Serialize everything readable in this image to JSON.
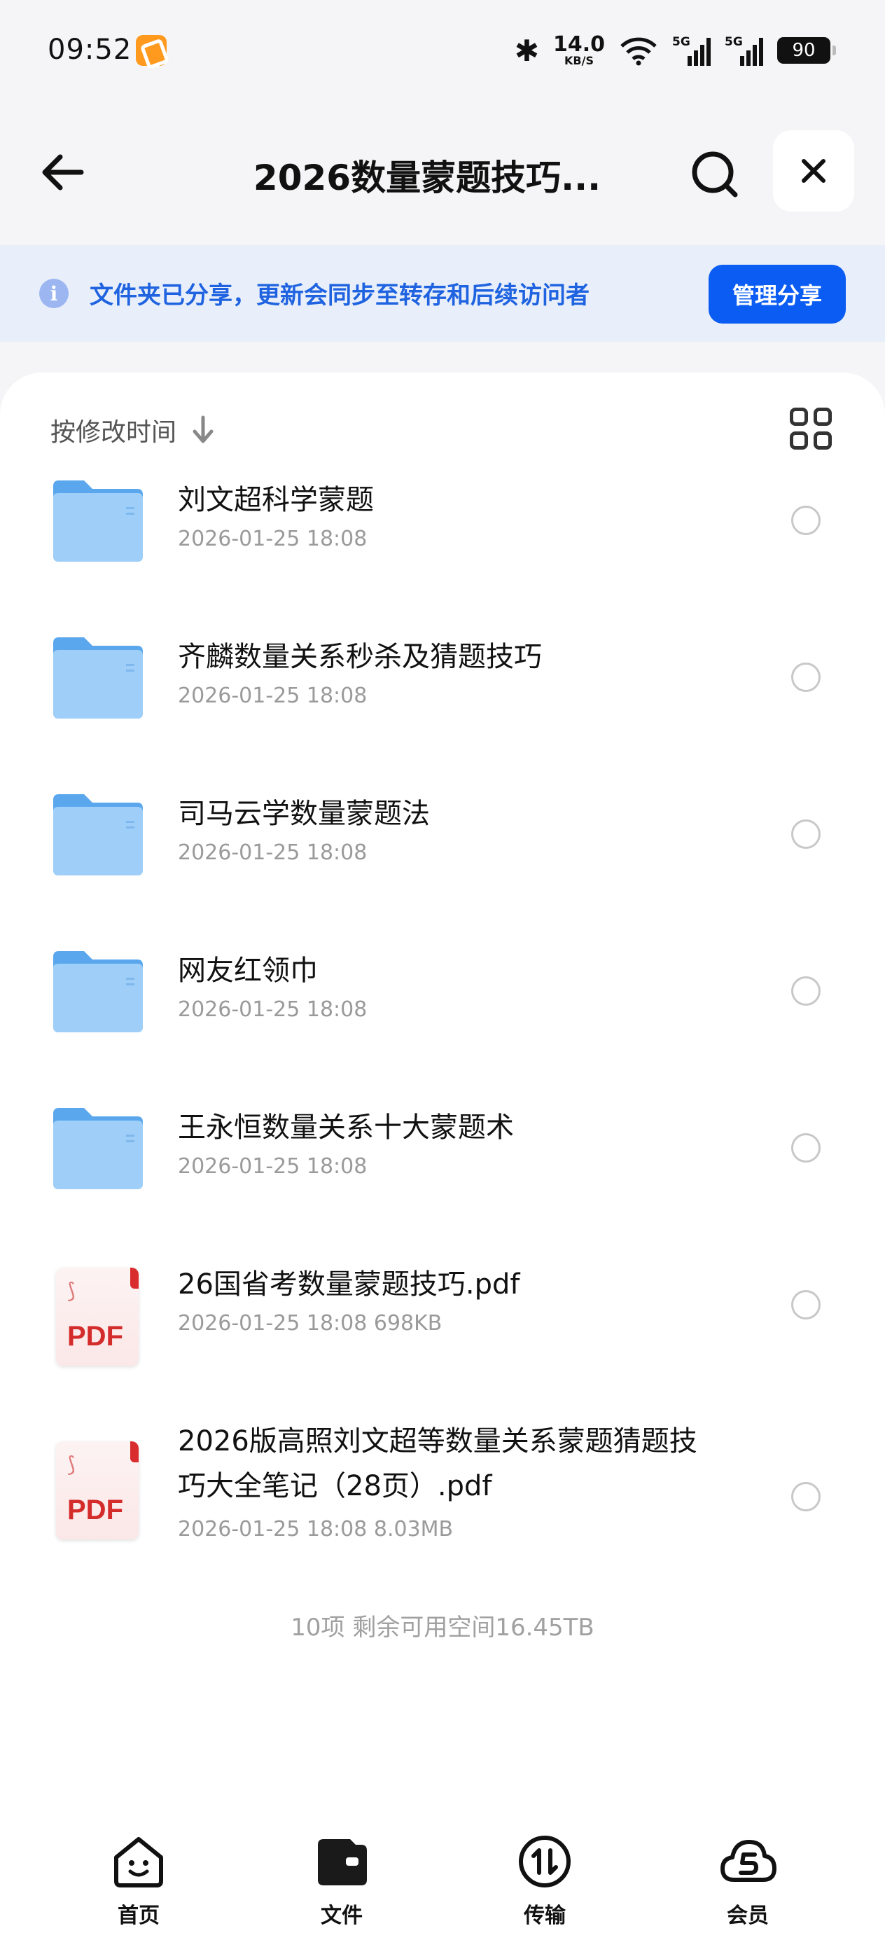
{
  "status_bar": {
    "time": "09:52",
    "net_speed_value": "14.0",
    "net_speed_unit": "KB/S",
    "sim1": "5G",
    "sim2": "5G",
    "battery": "90"
  },
  "header": {
    "title": "2026数量蒙题技巧..."
  },
  "banner": {
    "text": "文件夹已分享，更新会同步至转存和后续访问者",
    "button": "管理分享"
  },
  "sort": {
    "label": "按修改时间"
  },
  "files": [
    {
      "type": "folder",
      "name": "刘文超科学蒙题",
      "meta": "2026-01-25 18:08"
    },
    {
      "type": "folder",
      "name": "齐麟数量关系秒杀及猜题技巧",
      "meta": "2026-01-25 18:08"
    },
    {
      "type": "folder",
      "name": "司马云学数量蒙题法",
      "meta": "2026-01-25 18:08"
    },
    {
      "type": "folder",
      "name": "网友红领巾",
      "meta": "2026-01-25 18:08"
    },
    {
      "type": "folder",
      "name": "王永恒数量关系十大蒙题术",
      "meta": "2026-01-25 18:08"
    },
    {
      "type": "pdf",
      "name": "26国省考数量蒙题技巧.pdf",
      "meta": "2026-01-25 18:08  698KB",
      "badge": "PDF"
    },
    {
      "type": "pdf",
      "name": "2026版高照刘文超等数量关系蒙题猜题技巧大全笔记（28页）.pdf",
      "meta": "2026-01-25 18:08  8.03MB",
      "badge": "PDF"
    }
  ],
  "footer": {
    "count": "10项 剩余可用空间16.45TB"
  },
  "bottom_nav": [
    {
      "label": "首页",
      "icon": "home-face-icon"
    },
    {
      "label": "文件",
      "icon": "wallet-file-icon"
    },
    {
      "label": "传输",
      "icon": "transfer-icon"
    },
    {
      "label": "会员",
      "icon": "cloud-s-icon"
    }
  ],
  "colors": {
    "accent": "#0a5cf2",
    "banner_bg": "#e8effa",
    "banner_text": "#1f63e0",
    "folder": "#8fc4f4",
    "pdf_red": "#d42b2b"
  }
}
